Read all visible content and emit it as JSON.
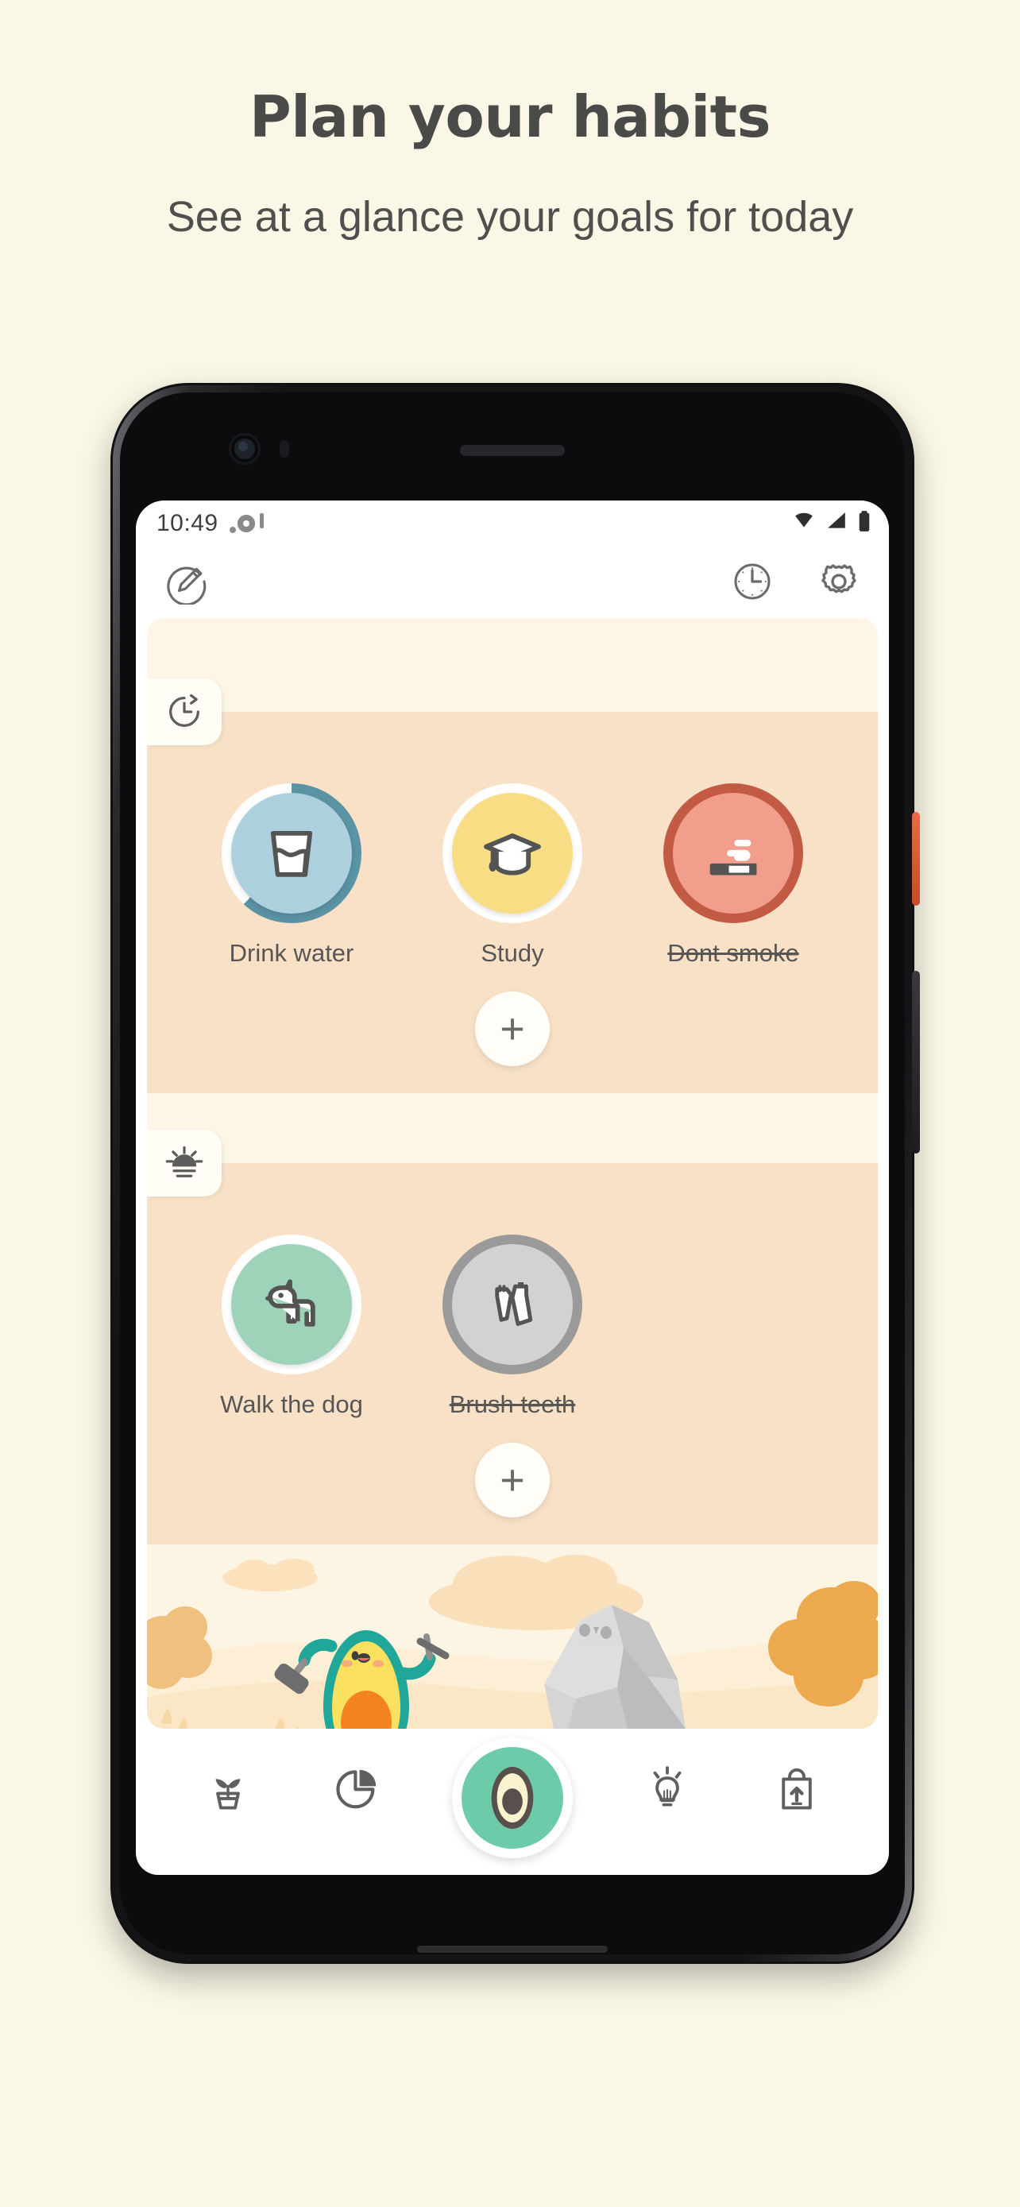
{
  "promo": {
    "title": "Plan your habits",
    "subtitle": "See at a glance your goals for today"
  },
  "colors": {
    "page_bg": "#fbf7e6",
    "title": "#4a4a48",
    "band": "#f8e1c6",
    "card": "#fdf6e7",
    "accent_green": "#6ecbaa",
    "water_blue": "#acd0dd",
    "water_ring": "#5a93a4",
    "study_yellow": "#f9dd85",
    "smoke_salmon": "#f29e8c",
    "smoke_ring": "#c25a44",
    "dog_green": "#9ed3ba",
    "teeth_gray": "#d2d2d2",
    "teeth_ring": "#9a9a9a"
  },
  "status_bar": {
    "time": "10:49",
    "icons": [
      "wifi-icon",
      "signal-icon",
      "battery-icon"
    ]
  },
  "app_bar": {
    "left_icon": "edit-pencil-circle-icon",
    "right_icons": [
      "clock-icon",
      "gear-icon"
    ]
  },
  "sections": [
    {
      "tab_icon": "history-clock-icon",
      "name": "morning",
      "habits": [
        {
          "label": "Drink water",
          "icon": "water-glass-icon",
          "done": false,
          "progress": 0.62,
          "fill": "#acd0dd",
          "ring": "#5a93a4",
          "ring_track": "#ffffff"
        },
        {
          "label": "Study",
          "icon": "graduation-cap-icon",
          "done": false,
          "progress": 0,
          "fill": "#f9dd85",
          "ring": "#f9dd85",
          "ring_track": "#ffffff"
        },
        {
          "label": "Dont smoke",
          "icon": "cigarette-icon",
          "done": true,
          "progress": 1,
          "fill": "#f29e8c",
          "ring": "#c25a44",
          "ring_track": "#c25a44"
        }
      ],
      "add_label": "+"
    },
    {
      "tab_icon": "sunrise-icon",
      "name": "afternoon",
      "habits": [
        {
          "label": "Walk the dog",
          "icon": "dog-icon",
          "done": false,
          "progress": 0,
          "fill": "#9ed3ba",
          "ring": "#9ed3ba",
          "ring_track": "#ffffff"
        },
        {
          "label": "Brush teeth",
          "icon": "toothbrush-icon",
          "done": true,
          "progress": 1,
          "fill": "#d2d2d2",
          "ring": "#9a9a9a",
          "ring_track": "#9a9a9a"
        }
      ],
      "add_label": "+"
    }
  ],
  "illustration": {
    "name": "avocado-mining-rock-illustration",
    "characters": [
      "avocado-character",
      "rock-monster",
      "pickaxe",
      "hammer"
    ]
  },
  "bottom_nav": {
    "items": [
      {
        "icon": "plant-pot-icon",
        "name": "nav-garden"
      },
      {
        "icon": "pie-chart-icon",
        "name": "nav-stats"
      },
      {
        "icon": "lightbulb-icon",
        "name": "nav-tips"
      },
      {
        "icon": "shopping-bag-icon",
        "name": "nav-shop"
      }
    ],
    "fab_icon": "avocado-icon"
  }
}
